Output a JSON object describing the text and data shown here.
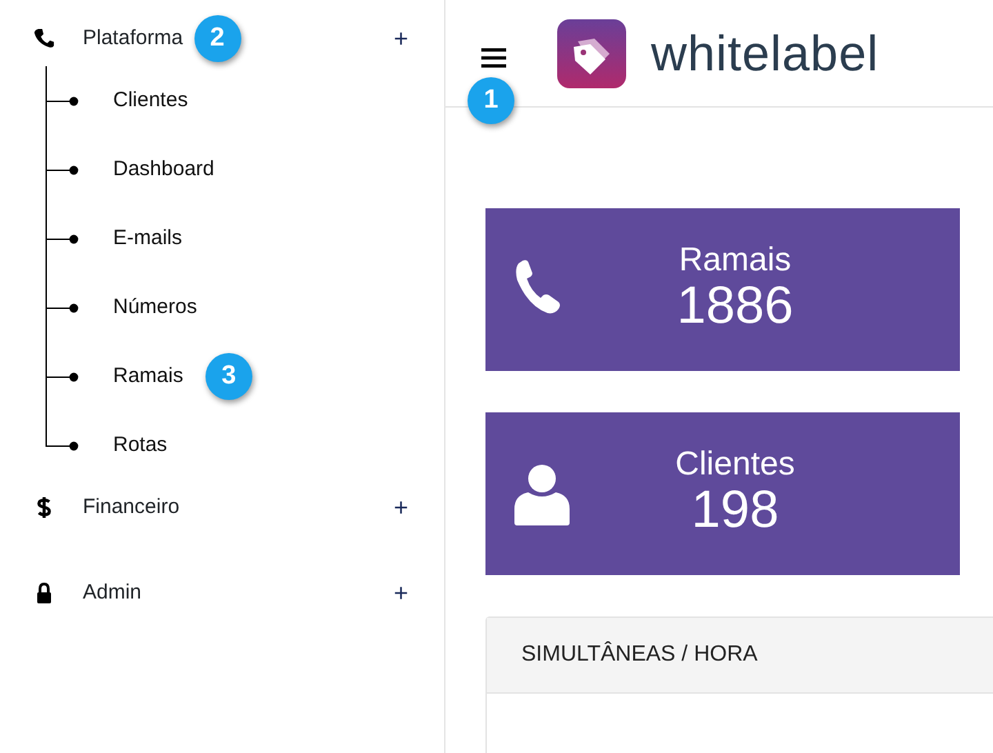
{
  "sidebar": {
    "items": [
      {
        "label": "Plataforma",
        "toggle": "+",
        "callout": "2",
        "children": [
          {
            "label": "Clientes"
          },
          {
            "label": "Dashboard"
          },
          {
            "label": "E-mails"
          },
          {
            "label": "Números"
          },
          {
            "label": "Ramais",
            "callout": "3"
          },
          {
            "label": "Rotas"
          }
        ]
      },
      {
        "label": "Financeiro",
        "toggle": "+"
      },
      {
        "label": "Admin",
        "toggle": "+"
      }
    ]
  },
  "topbar": {
    "menu_callout": "1",
    "logo_text": "whitelabel"
  },
  "stats": [
    {
      "title": "Ramais",
      "value": "1886"
    },
    {
      "title": "Clientes",
      "value": "198"
    }
  ],
  "panel": {
    "title": "SIMULTÂNEAS / HORA"
  }
}
